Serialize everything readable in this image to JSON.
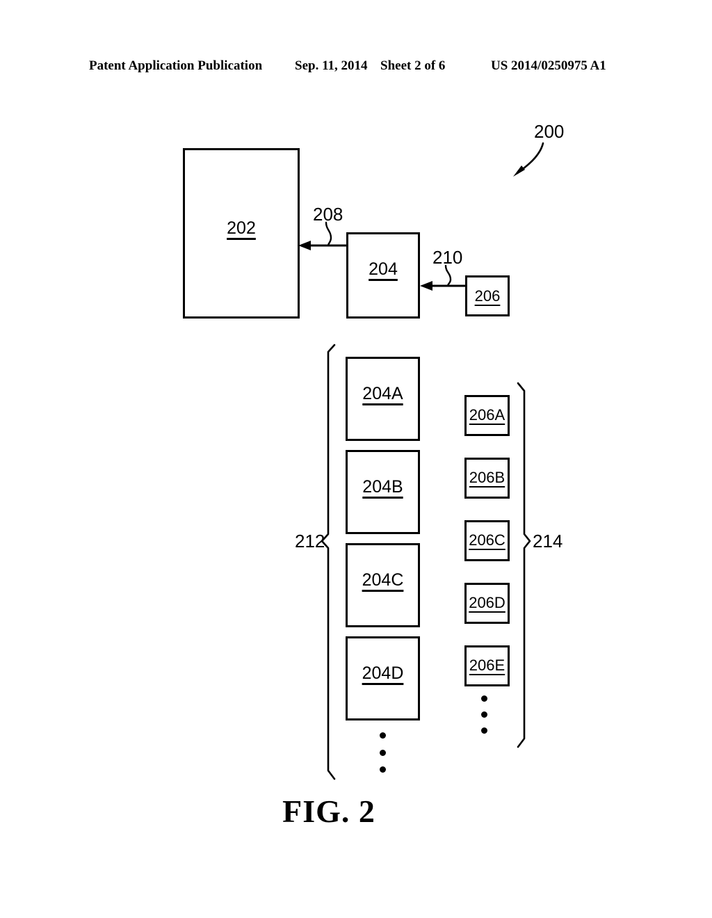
{
  "header": {
    "publication": "Patent Application Publication",
    "date": "Sep. 11, 2014",
    "sheet": "Sheet 2 of 6",
    "patent_number": "US 2014/0250975 A1"
  },
  "figure": {
    "caption": "FIG. 2",
    "system_ref": "200",
    "boxes": {
      "main": [
        {
          "id": "202",
          "label": "202"
        },
        {
          "id": "204",
          "label": "204"
        },
        {
          "id": "206",
          "label": "206"
        }
      ],
      "column_204": [
        {
          "id": "204A",
          "label": "204A"
        },
        {
          "id": "204B",
          "label": "204B"
        },
        {
          "id": "204C",
          "label": "204C"
        },
        {
          "id": "204D",
          "label": "204D"
        }
      ],
      "column_206": [
        {
          "id": "206A",
          "label": "206A"
        },
        {
          "id": "206B",
          "label": "206B"
        },
        {
          "id": "206C",
          "label": "206C"
        },
        {
          "id": "206D",
          "label": "206D"
        },
        {
          "id": "206E",
          "label": "206E"
        }
      ]
    },
    "connectors": [
      {
        "id": "208",
        "label": "208",
        "from": "204",
        "to": "202"
      },
      {
        "id": "210",
        "label": "210",
        "from": "206",
        "to": "204"
      }
    ],
    "braces": [
      {
        "id": "212",
        "label": "212",
        "groups": "column_204"
      },
      {
        "id": "214",
        "label": "214",
        "groups": "column_206"
      }
    ],
    "ellipsis_marker": "⋮"
  },
  "colors": {
    "ink": "#000000",
    "paper": "#ffffff"
  }
}
